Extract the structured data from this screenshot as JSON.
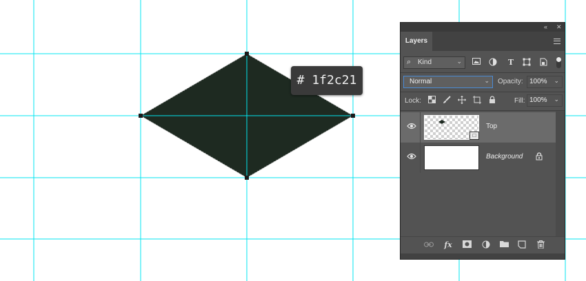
{
  "canvas": {
    "guide_color": "#00e5f0",
    "shape_fill": "#1e2a21",
    "anchor_color": "#1a1a1a"
  },
  "tooltip": {
    "text": "# 1f2c21"
  },
  "panel": {
    "titlebar": {
      "collapse_glyph": "«",
      "close_glyph": "✕"
    },
    "tab": {
      "label": "Layers"
    },
    "menu_icon": "panel-menu-icon",
    "filter": {
      "search_glyph": "⌕",
      "kind_label": "Kind",
      "icons": [
        "image-filter-icon",
        "adjustment-filter-icon",
        "type-filter-icon",
        "shape-filter-icon",
        "smart-object-filter-icon"
      ]
    },
    "blend_mode": "Normal",
    "opacity": {
      "label": "Opacity:",
      "value": "100%"
    },
    "lock": {
      "label": "Lock:"
    },
    "fill": {
      "label": "Fill:",
      "value": "100%"
    },
    "layers": [
      {
        "name": "Top",
        "selected": true,
        "visible": true
      },
      {
        "name": "Background",
        "selected": false,
        "visible": true,
        "locked": true
      }
    ],
    "bottom_icons": [
      "link-layers-icon",
      "fx-icon",
      "add-mask-icon",
      "adjustment-layer-icon",
      "new-group-icon",
      "new-layer-icon",
      "delete-layer-icon"
    ],
    "fx_label": "fx"
  }
}
